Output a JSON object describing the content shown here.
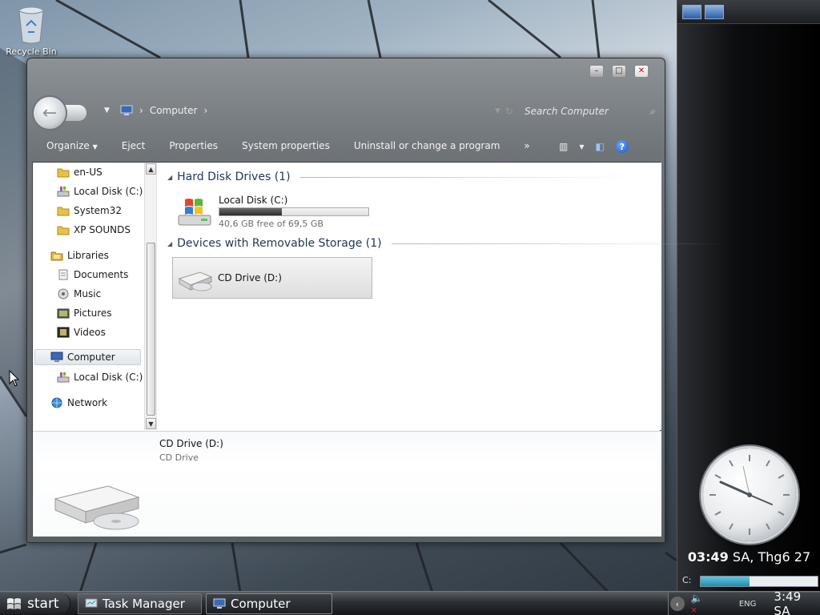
{
  "desktop": {
    "recycle_bin_label": "Recycle Bin"
  },
  "window": {
    "title_controls": {
      "minimize": "–",
      "maximize": "□",
      "close": "✕"
    },
    "address": {
      "root_icon": "computer-icon",
      "path": [
        "Computer"
      ]
    },
    "search": {
      "placeholder": "Search Computer"
    },
    "toolbar": {
      "items": [
        "Organize",
        "Eject",
        "Properties",
        "System properties",
        "Uninstall or change a program"
      ],
      "more": "»"
    },
    "nav_pane": {
      "items": [
        {
          "label": "en-US",
          "icon": "folder-icon",
          "indent": 1
        },
        {
          "label": "Local Disk (C:)",
          "icon": "drive-icon",
          "indent": 1
        },
        {
          "label": "System32",
          "icon": "folder-icon",
          "indent": 1
        },
        {
          "label": "XP SOUNDS",
          "icon": "folder-icon",
          "indent": 1
        },
        {
          "label": "Libraries",
          "icon": "libraries-icon",
          "indent": 0
        },
        {
          "label": "Documents",
          "icon": "documents-icon",
          "indent": 1
        },
        {
          "label": "Music",
          "icon": "music-icon",
          "indent": 1
        },
        {
          "label": "Pictures",
          "icon": "pictures-icon",
          "indent": 1
        },
        {
          "label": "Videos",
          "icon": "videos-icon",
          "indent": 1
        },
        {
          "label": "Computer",
          "icon": "computer-icon",
          "indent": 0,
          "selected": true
        },
        {
          "label": "Local Disk (C:)",
          "icon": "drive-icon",
          "indent": 1
        },
        {
          "label": "Network",
          "icon": "network-icon",
          "indent": 0
        }
      ]
    },
    "content": {
      "groups": [
        {
          "title": "Hard Disk Drives (1)"
        },
        {
          "title": "Devices with Removable Storage (1)"
        }
      ],
      "local_disk": {
        "label": "Local Disk (C:)",
        "free_text": "40,6 GB free of 69,5 GB",
        "used_fraction": 0.42
      },
      "cd_drive": {
        "label": "CD Drive (D:)"
      }
    },
    "details": {
      "name": "CD Drive (D:)",
      "type": "CD Drive"
    }
  },
  "sidebar": {
    "clock": {
      "time_bold": "03:49",
      "rest": " SA, Thg6 27"
    },
    "drive_meter": {
      "label": "C:",
      "used_fraction": 0.42
    }
  },
  "taskbar": {
    "start_label": "start",
    "tasks": [
      {
        "label": "Task Manager",
        "icon": "task-manager-icon"
      },
      {
        "label": "Computer",
        "icon": "computer-icon",
        "active": true
      }
    ],
    "tray": {
      "language": "ENG",
      "time": "3:49 SA"
    }
  },
  "colors": {
    "window_chrome": "#6e7378",
    "accent": "#1e8fb0",
    "group_header": "#1e3657"
  }
}
